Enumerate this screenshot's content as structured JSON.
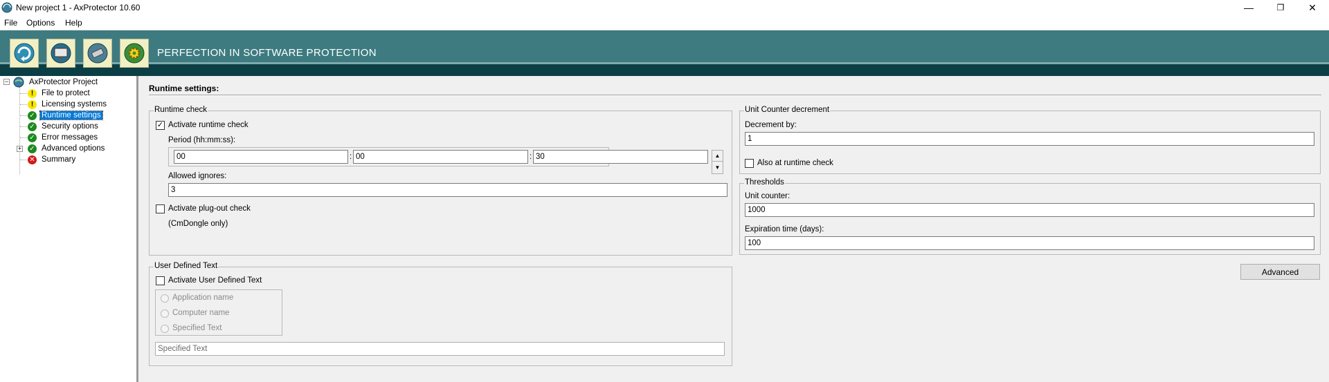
{
  "window": {
    "title": "New project 1 - AxProtector 10.60",
    "minimize": "—",
    "restore": "❐",
    "close": "✕"
  },
  "menu": [
    "File",
    "Options",
    "Help"
  ],
  "banner": {
    "slogan": "PERFECTION IN SOFTWARE PROTECTION",
    "tools": [
      {
        "icon": "refresh-globe-icon",
        "color": "#2f8fb4"
      },
      {
        "icon": "monitor-globe-icon",
        "color": "#2a6e8c"
      },
      {
        "icon": "dongle-globe-icon",
        "color": "#4b7f93"
      },
      {
        "icon": "gear-globe-icon",
        "color": "#3a8e3a"
      }
    ]
  },
  "tree": {
    "root": "AxProtector Project",
    "items": [
      {
        "label": "File to protect",
        "status": "warn"
      },
      {
        "label": "Licensing systems",
        "status": "warn"
      },
      {
        "label": "Runtime settings",
        "status": "ok",
        "selected": true
      },
      {
        "label": "Security options",
        "status": "ok"
      },
      {
        "label": "Error messages",
        "status": "ok"
      },
      {
        "label": "Advanced options",
        "status": "ok",
        "expandable": true
      },
      {
        "label": "Summary",
        "status": "err"
      }
    ]
  },
  "page": {
    "heading": "Runtime settings:",
    "runtime_check": {
      "legend": "Runtime check",
      "activate_label": "Activate runtime check",
      "activate_checked": "✓",
      "period_label": "Period (hh:mm:ss):",
      "hours": "00",
      "minutes": "00",
      "seconds": "30",
      "sep": ":",
      "spin_up": "▲",
      "spin_down": "▼",
      "allowed_ignores_label": "Allowed ignores:",
      "allowed_ignores": "3",
      "plugout_label": "Activate plug-out check",
      "plugout_note": "(CmDongle only)"
    },
    "user_defined_text": {
      "legend": "User Defined Text",
      "activate_label": "Activate User Defined Text",
      "options": [
        "Application name",
        "Computer name",
        "Specified Text"
      ],
      "text_value": "Specified Text"
    },
    "unit_counter": {
      "legend": "Unit Counter decrement",
      "decrement_label": "Decrement by:",
      "decrement_value": "1",
      "also_label": "Also at runtime check"
    },
    "thresholds": {
      "legend": "Thresholds",
      "unit_counter_label": "Unit counter:",
      "unit_counter_value": "1000",
      "expiration_label": "Expiration time (days):",
      "expiration_value": "100"
    },
    "advanced_button": "Advanced"
  }
}
